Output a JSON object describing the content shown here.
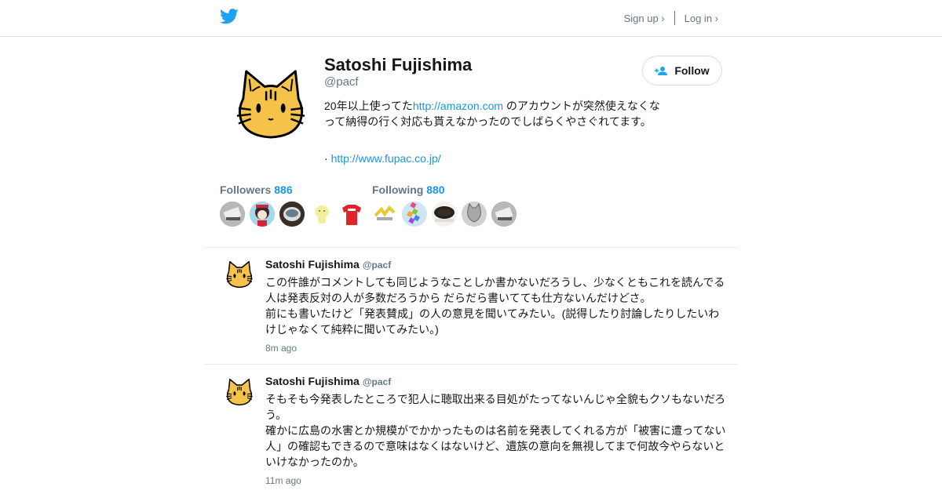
{
  "header": {
    "logo_icon": "twitter-bird-icon",
    "signup_label": "Sign up ›",
    "login_label": "Log in ›",
    "accent_color": "#1da1f2"
  },
  "profile": {
    "name": "Satoshi Fujishima",
    "handle": "@pacf",
    "bio_prefix": "20年以上使ってた",
    "bio_link": "http://amazon.com",
    "bio_suffix": " のアカウントが突然使えなくなって納得の行く対応も貰えなかったのでしばらくやさぐれてます。",
    "site_prefix": "· ",
    "site_link": "http://www.fupac.co.jp/",
    "follow_label": "Follow",
    "follow_icon": "add-person-icon"
  },
  "stats": {
    "followers_label": "Followers",
    "followers_count": "886",
    "following_label": "Following",
    "following_count": "880"
  },
  "follower_avatars": [
    "gray-photo",
    "anime-character",
    "cup-photo",
    "yellow-creature",
    "red-shirt"
  ],
  "following_avatars": [
    "yellow-logo",
    "colorful-blocks",
    "coffee-cup",
    "gray-cat",
    "gray-photo"
  ],
  "tweets": [
    {
      "name": "Satoshi Fujishima",
      "handle": "@pacf",
      "lines": [
        "この件誰がコメントしても同じようなことしか書かないだろうし、少なくともこれを読んでる",
        "人は発表反対の人が多数だろうから だらだら書いてても仕方ないんだけどさ。",
        "前にも書いたけど「発表賛成」の人の意見を聞いてみたい。(説得したり討論したりしたいわ",
        "けじゃなくて純粋に聞いてみたい。)"
      ],
      "time": "8m ago"
    },
    {
      "name": "Satoshi Fujishima",
      "handle": "@pacf",
      "lines": [
        "そもそも今発表したところで犯人に聴取出来る目処がたってないんじゃ全貌もクソもないだろ",
        "う。",
        "確かに広島の水害とか規模がでかかったものは名前を発表してくれる方が「被害に遭ってない",
        "人」の確認もできるので意味はなくはないけど、遺族の意向を無視してまで何故今やらないと",
        "いけなかったのか。"
      ],
      "time": "11m ago"
    }
  ]
}
